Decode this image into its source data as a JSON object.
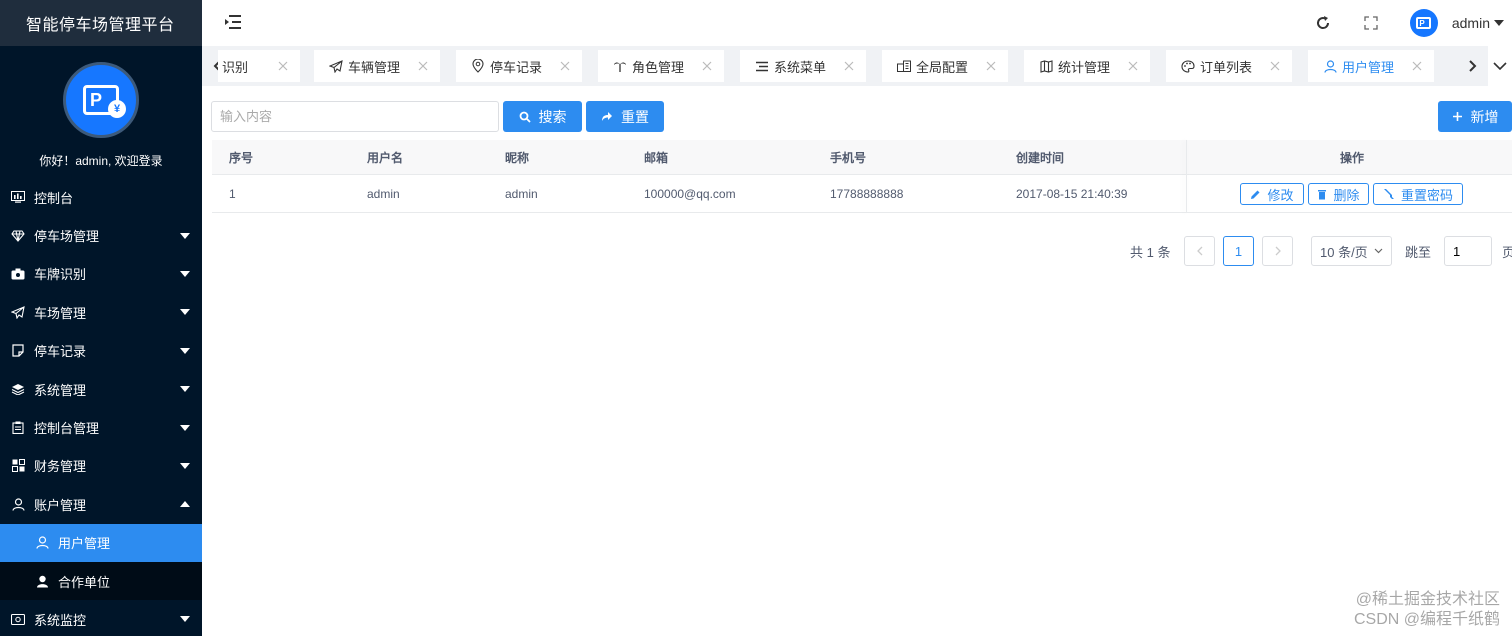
{
  "app": {
    "title": "智能停车场管理平台",
    "welcome": "你好！admin, 欢迎登录"
  },
  "sidebar": {
    "items": [
      {
        "label": "控制台",
        "icon": "dashboard-icon",
        "caret": ""
      },
      {
        "label": "停车场管理",
        "icon": "diamond-icon",
        "caret": "down"
      },
      {
        "label": "车牌识别",
        "icon": "camera-icon",
        "caret": "down"
      },
      {
        "label": "车场管理",
        "icon": "paper-plane-icon",
        "caret": "down"
      },
      {
        "label": "停车记录",
        "icon": "note-icon",
        "caret": "down"
      },
      {
        "label": "系统管理",
        "icon": "layers-icon",
        "caret": "down"
      },
      {
        "label": "控制台管理",
        "icon": "clipboard-icon",
        "caret": "down"
      },
      {
        "label": "财务管理",
        "icon": "grid-icon",
        "caret": "down"
      },
      {
        "label": "账户管理",
        "icon": "user-icon",
        "caret": "up"
      },
      {
        "label": "用户管理",
        "icon": "user-outline-icon",
        "caret": "",
        "sub": true,
        "active": true
      },
      {
        "label": "合作单位",
        "icon": "user-solid-icon",
        "caret": "",
        "sub": true
      },
      {
        "label": "系统监控",
        "icon": "monitor-icon",
        "caret": "down"
      }
    ]
  },
  "header": {
    "username": "admin"
  },
  "tabs": [
    {
      "label": "识别",
      "icon": ""
    },
    {
      "label": "车辆管理",
      "icon": "paper-plane-icon"
    },
    {
      "label": "停车记录",
      "icon": "location-icon"
    },
    {
      "label": "角色管理",
      "icon": "palm-icon"
    },
    {
      "label": "系统菜单",
      "icon": "list-icon"
    },
    {
      "label": "全局配置",
      "icon": "building-icon"
    },
    {
      "label": "统计管理",
      "icon": "map-icon"
    },
    {
      "label": "订单列表",
      "icon": "palette-icon"
    },
    {
      "label": "用户管理",
      "icon": "user-outline-icon",
      "active": true
    }
  ],
  "toolbar": {
    "search_placeholder": "输入内容",
    "search_label": "搜索",
    "reset_label": "重置",
    "add_label": "新增"
  },
  "table": {
    "columns": [
      "序号",
      "用户名",
      "昵称",
      "邮箱",
      "手机号",
      "创建时间",
      "操作"
    ],
    "rows": [
      {
        "index": "1",
        "username": "admin",
        "nickname": "admin",
        "email": "100000@qq.com",
        "phone": "17788888888",
        "created": "2017-08-15 21:40:39"
      }
    ],
    "actions": {
      "edit": "修改",
      "delete": "删除",
      "reset_pwd": "重置密码"
    }
  },
  "pagination": {
    "total_text": "共 1 条",
    "current_page": "1",
    "page_size": "10 条/页",
    "jump_label": "跳至",
    "jump_value": "1",
    "page_suffix": "页"
  },
  "watermark": {
    "line1": "@稀土掘金技术社区",
    "line2": "CSDN @编程千纸鹤"
  },
  "colors": {
    "primary": "#2d8cf0",
    "sidebar_bg": "#001529",
    "header_brand_bg": "#1f2d3d"
  }
}
